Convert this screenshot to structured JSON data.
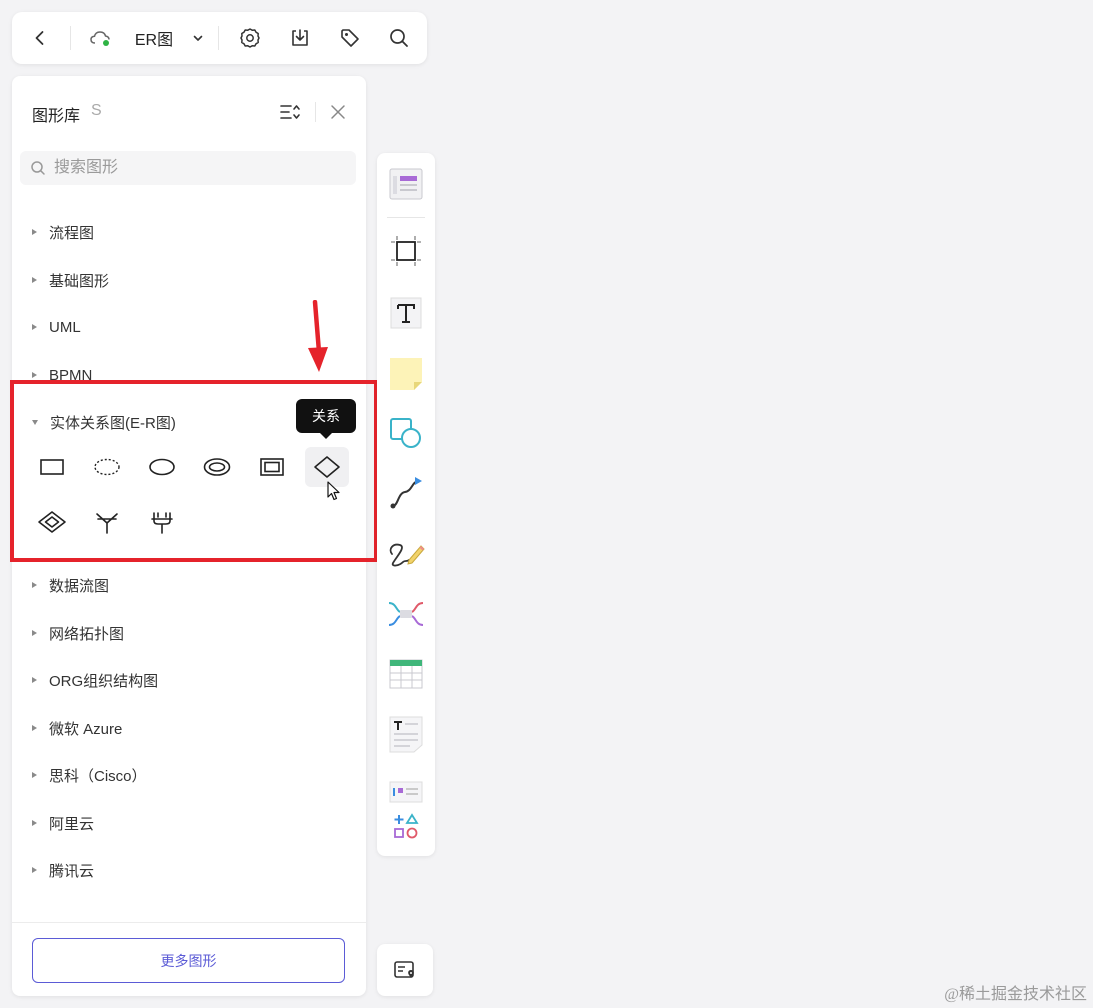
{
  "topbar": {
    "doc_title": "ER图",
    "icons": [
      "back-icon",
      "cloud-sync-icon",
      "chevron-down-icon",
      "settings-icon",
      "download-icon",
      "tag-icon",
      "search-icon"
    ]
  },
  "library": {
    "title": "图形库",
    "shortcut": "S",
    "search_placeholder": "搜索图形",
    "categories": [
      {
        "label": "流程图",
        "expanded": false
      },
      {
        "label": "基础图形",
        "expanded": false
      },
      {
        "label": "UML",
        "expanded": false
      },
      {
        "label": "BPMN",
        "expanded": false
      },
      {
        "label": "实体关系图(E-R图)",
        "expanded": true
      },
      {
        "label": "数据流图",
        "expanded": false
      },
      {
        "label": "网络拓扑图",
        "expanded": false
      },
      {
        "label": "ORG组织结构图",
        "expanded": false
      },
      {
        "label": "微软 Azure",
        "expanded": false
      },
      {
        "label": "思科（Cisco）",
        "expanded": false
      },
      {
        "label": "阿里云",
        "expanded": false
      },
      {
        "label": "腾讯云",
        "expanded": false
      }
    ],
    "er_shapes": [
      "entity-rect-icon",
      "dashed-ellipse-icon",
      "ellipse-icon",
      "double-ellipse-icon",
      "weak-entity-icon",
      "relationship-diamond-icon",
      "double-diamond-icon",
      "one-to-many-icon",
      "many-to-many-icon"
    ],
    "tooltip": "关系",
    "more_button": "更多图形"
  },
  "toolbar": {
    "tools": [
      "template-icon",
      "frame-icon",
      "text-icon",
      "sticky-note-icon",
      "shapes-icon",
      "connector-icon",
      "pen-icon",
      "mindmap-icon",
      "table-icon",
      "text-block-icon",
      "card-icon",
      "more-shapes-icon"
    ]
  },
  "watermark": "@稀土掘金技术社区",
  "colors": {
    "accent": "#5b5bd6",
    "highlight": "#e5232b",
    "online": "#2fb344"
  }
}
